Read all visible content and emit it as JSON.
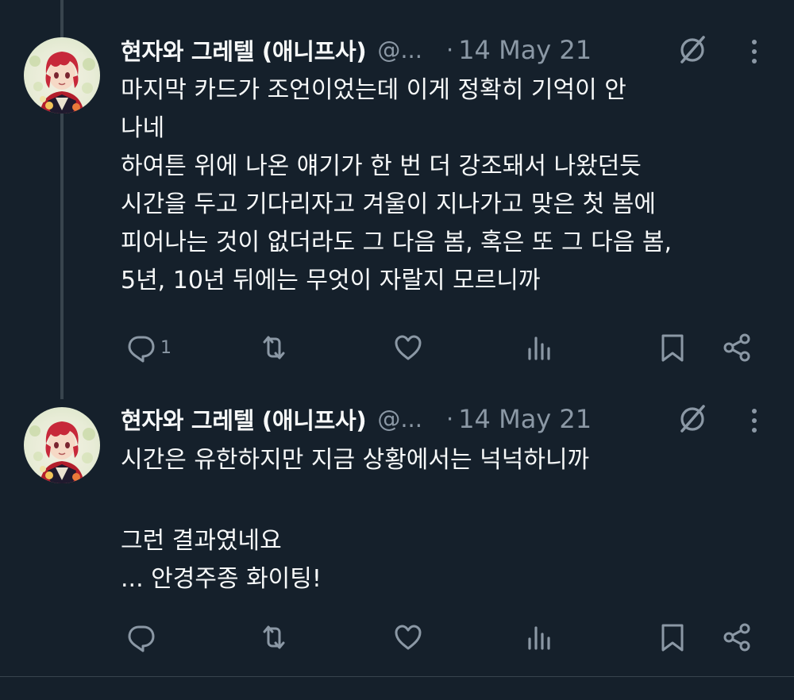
{
  "tweets": [
    {
      "author_name": "현자와 그레텔 (애니프사)",
      "author_handle": "@...",
      "separator": "·",
      "timestamp": "14 May 21",
      "body_lines": [
        "마지막 카드가 조언이었는데 이게 정확히 기억이 안",
        "나네",
        "하여튼 위에 나온 얘기가 한 번 더 강조돼서 나왔던듯",
        "시간을 두고 기다리자고 겨울이 지나가고 맞은 첫 봄에",
        "피어나는 것이 없더라도 그 다음 봄, 혹은 또 그 다음 봄,",
        "5년, 10년 뒤에는 무엇이 자랄지 모르니까"
      ],
      "reply_count": "1",
      "retweet_count": "",
      "like_count": "",
      "view_count": ""
    },
    {
      "author_name": "현자와 그레텔 (애니프사)",
      "author_handle": "@...",
      "separator": "·",
      "timestamp": "14 May 21",
      "body_lines": [
        "시간은 유한하지만 지금 상황에서는 넉넉하니까",
        "",
        "그런 결과였네요",
        "... 안경주종 화이팅!"
      ],
      "reply_count": "",
      "retweet_count": "",
      "like_count": "",
      "view_count": ""
    }
  ],
  "icons": {
    "reply": "reply-icon",
    "retweet": "retweet-icon",
    "like": "heart-icon",
    "views": "views-icon",
    "bookmark": "bookmark-icon",
    "share": "share-icon",
    "grok": "grok-icon",
    "more": "more-icon"
  },
  "colors": {
    "background": "#15202b",
    "text_primary": "#f7f9f9",
    "text_secondary": "#8b98a5",
    "thread_line": "#38444d",
    "avatar_hair": "#c7283a"
  }
}
